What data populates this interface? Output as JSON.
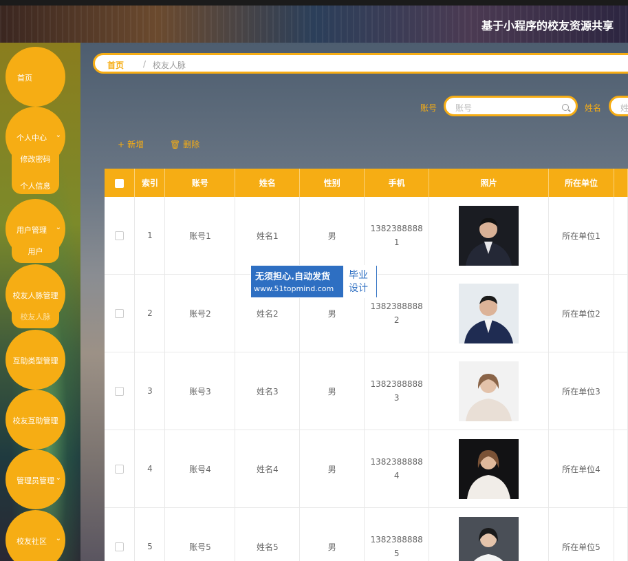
{
  "header": {
    "title": "基于小程序的校友资源共享"
  },
  "sidebar": {
    "home": "首页",
    "personal_center": "个人中心",
    "change_password": "修改密码",
    "personal_info": "个人信息",
    "user_mgmt": "用户管理",
    "user": "用户",
    "alumni_network_mgmt": "校友人脉管理",
    "alumni_network": "校友人脉",
    "help_type_mgmt": "互助类型管理",
    "alumni_help_mgmt": "校友互助管理",
    "admin_mgmt": "管理员管理",
    "alumni_community": "校友社区"
  },
  "breadcrumb": {
    "home": "首页",
    "separator": "/",
    "current": "校友人脉"
  },
  "search": {
    "account_label": "账号",
    "account_placeholder": "账号",
    "name_label": "姓名",
    "name_placeholder": "姓"
  },
  "toolbar": {
    "add": "新增",
    "delete": "删除"
  },
  "table": {
    "headers": [
      "索引",
      "账号",
      "姓名",
      "性别",
      "手机",
      "照片",
      "所在单位"
    ],
    "rows": [
      {
        "index": "1",
        "account": "账号1",
        "name": "姓名1",
        "gender": "男",
        "phone_a": "1382388888",
        "phone_b": "1",
        "unit": "所在单位1"
      },
      {
        "index": "2",
        "account": "账号2",
        "name": "姓名2",
        "gender": "男",
        "phone_a": "1382388888",
        "phone_b": "2",
        "unit": "所在单位2"
      },
      {
        "index": "3",
        "account": "账号3",
        "name": "姓名3",
        "gender": "男",
        "phone_a": "1382388888",
        "phone_b": "3",
        "unit": "所在单位3"
      },
      {
        "index": "4",
        "account": "账号4",
        "name": "姓名4",
        "gender": "男",
        "phone_a": "1382388888",
        "phone_b": "4",
        "unit": "所在单位4"
      },
      {
        "index": "5",
        "account": "账号5",
        "name": "姓名5",
        "gender": "男",
        "phone_a": "1382388888",
        "phone_b": "5",
        "unit": "所在单位5"
      }
    ]
  },
  "watermark": {
    "line1": "无须担心.自动发货",
    "line2": "www.51topmind.com",
    "right1": "毕业",
    "right2": "设计"
  },
  "colors": {
    "accent": "#f6ad14",
    "watermark_blue": "#2e6fc2"
  }
}
